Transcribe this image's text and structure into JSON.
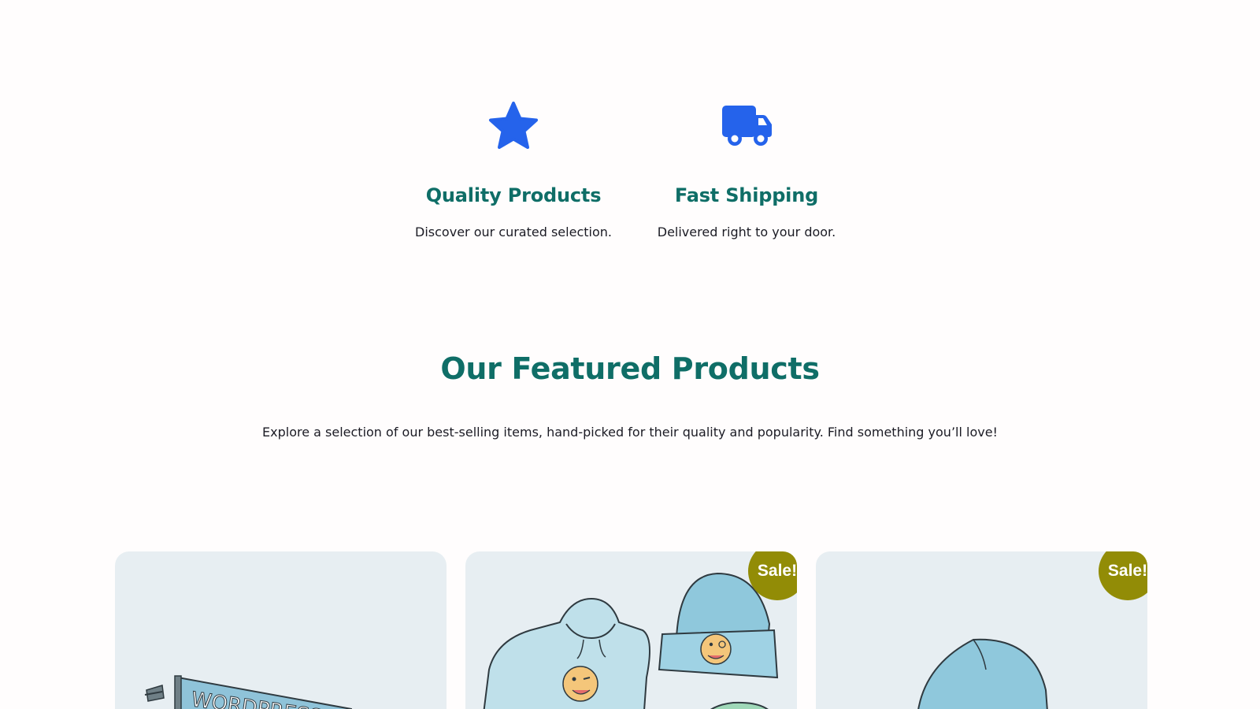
{
  "features": [
    {
      "icon": "star-icon",
      "title": "Quality Products",
      "text": "Discover our curated selection."
    },
    {
      "icon": "truck-icon",
      "title": "Fast Shipping",
      "text": "Delivered right to your door."
    }
  ],
  "featured": {
    "title": "Our Featured Products",
    "description": "Explore a selection of our best-selling items, hand-picked for their quality and popularity. Find something you’ll love!"
  },
  "products": [
    {
      "image": "pennant-illustration",
      "sale_badge": ""
    },
    {
      "image": "hoodie-beanie-illustration",
      "sale_badge": "Sale!"
    },
    {
      "image": "beanie-illustration",
      "sale_badge": "Sale!"
    }
  ],
  "colors": {
    "accent": "#0f6e67",
    "icon": "#2563eb",
    "sale_badge": "#928c06",
    "card_background": "#e7eef2"
  }
}
